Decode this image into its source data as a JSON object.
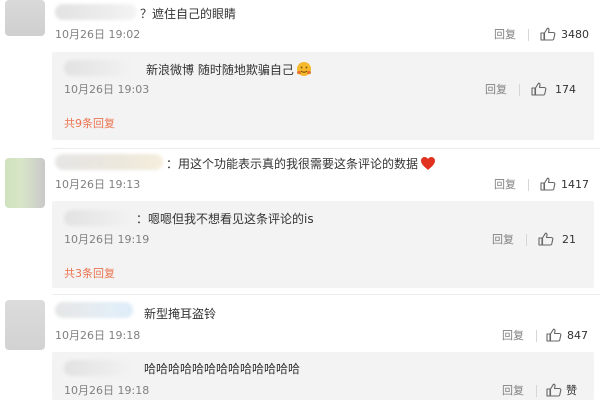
{
  "comments": [
    {
      "text": "？遮住自己的眼睛",
      "time": "10月26日 19:02",
      "reply_label": "回复",
      "likes": "3480",
      "replies": [
        {
          "text": "新浪微博 随时随地欺骗自己",
          "time": "10月26日 19:03",
          "reply_label": "回复",
          "likes": "174"
        }
      ],
      "more_replies": "共9条回复"
    },
    {
      "text": "：用这个功能表示真的我很需要这条评论的数据",
      "time": "10月26日 19:13",
      "reply_label": "回复",
      "likes": "1417",
      "replies": [
        {
          "text": "：嗯嗯但我不想看见这条评论的is",
          "time": "10月26日 19:19",
          "reply_label": "回复",
          "likes": "21"
        }
      ],
      "more_replies": "共3条回复"
    },
    {
      "text": "新型掩耳盗铃",
      "time": "10月26日 19:18",
      "reply_label": "回复",
      "likes": "847",
      "replies": [
        {
          "text": "哈哈哈哈哈哈哈哈哈哈哈哈哈",
          "time": "10月26日 19:18",
          "reply_label": "回复",
          "likes": "赞"
        }
      ]
    }
  ],
  "colors": {
    "link": "#eb7350",
    "meta": "#808080",
    "reply_bg": "#f3f3f3",
    "heart": "#e0321e"
  },
  "icons": [
    "like-thumb-icon",
    "heart-emoji-icon",
    "hug-emoji-icon"
  ]
}
